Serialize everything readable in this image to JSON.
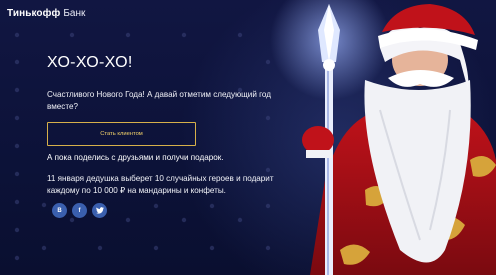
{
  "header": {
    "brand": "Тинькофф",
    "brand_sub": "Банк"
  },
  "hero": {
    "title": "ХО-ХО-ХО!",
    "lead": "Счастливого Нового Года! А давай отметим следующий год вместе?",
    "cta_label": "Стать клиентом",
    "share_text": "А пока поделись с друзьями и получи подарок.",
    "promo": "11 января дедушка выберет 10 случайных героев и подарит каждому по 10 000 ₽ на мандарины и конфеты."
  },
  "socials": [
    {
      "label": "В",
      "icon": "vk-icon"
    },
    {
      "label": "f",
      "icon": "facebook-icon"
    },
    {
      "label": "",
      "icon": "twitter-icon"
    }
  ],
  "colors": {
    "background": "#0c1238",
    "accent": "#d6b04a",
    "social": "#3a5fae"
  }
}
